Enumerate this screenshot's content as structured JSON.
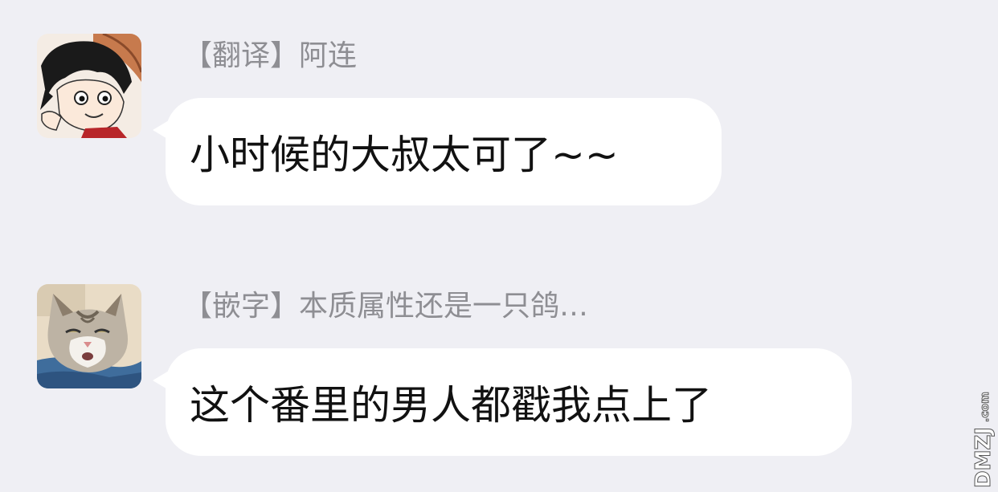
{
  "messages": [
    {
      "sender": "【翻译】阿连",
      "text": "小时候的大叔太可了~~",
      "avatar_icon": "manga-boy-avatar-icon"
    },
    {
      "sender": "【嵌字】本质属性还是一只鸽…",
      "text": "这个番里的男人都戳我点上了",
      "avatar_icon": "cat-avatar-icon"
    }
  ],
  "watermark": {
    "text": "DMZJ.com",
    "icon": "dmzj-logo-icon"
  },
  "colors": {
    "background": "#efeff4",
    "bubble": "#ffffff",
    "sender_text": "#8e8e93",
    "message_text": "#111111"
  }
}
